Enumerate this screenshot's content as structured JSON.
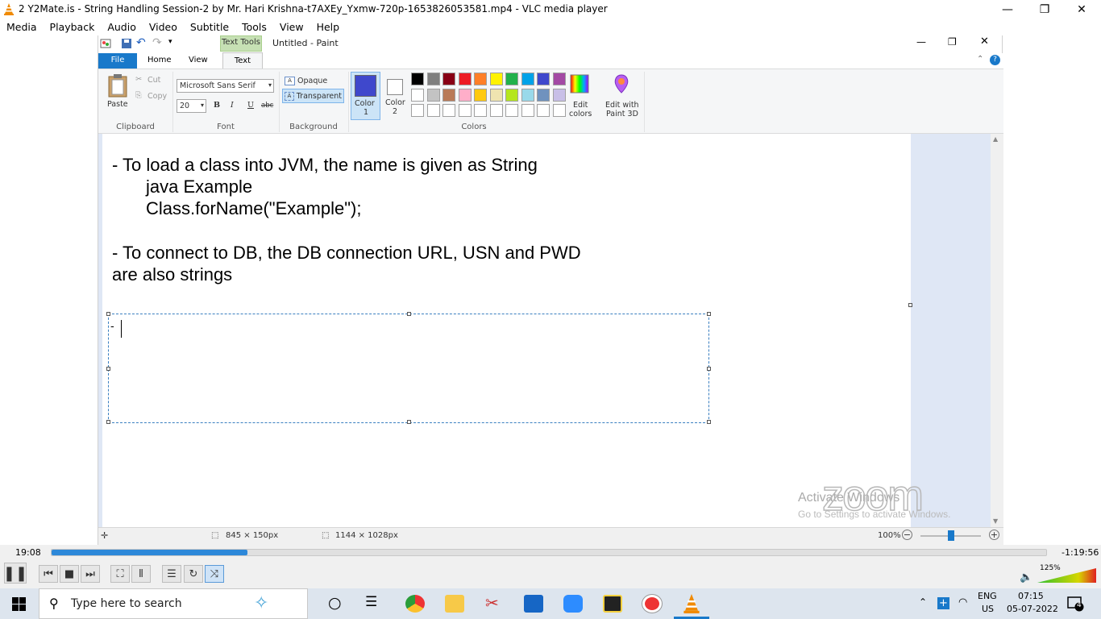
{
  "vlc": {
    "title": "2 Y2Mate.is - String Handling Session-2  by Mr. Hari Krishna-t7AXEy_Yxmw-720p-1653826053581.mp4 - VLC media player",
    "menu": [
      "Media",
      "Playback",
      "Audio",
      "Video",
      "Subtitle",
      "Tools",
      "View",
      "Help"
    ],
    "elapsed": "19:08",
    "remaining": "-1:19:56",
    "progress": 0.197,
    "volume_label": "125%",
    "volume_level": 1.0
  },
  "paint": {
    "title": "Untitled - Paint",
    "contextual_tab": "Text Tools",
    "tabs": [
      "File",
      "Home",
      "View",
      "Text"
    ],
    "clipboard": {
      "paste": "Paste",
      "cut": "Cut",
      "copy": "Copy",
      "label": "Clipboard"
    },
    "font": {
      "family": "Microsoft Sans Serif",
      "size": "20",
      "bold": "B",
      "italic": "I",
      "underline": "U",
      "strike": "abc",
      "label": "Font"
    },
    "background": {
      "opaque": "Opaque",
      "transparent": "Transparent",
      "label": "Background"
    },
    "colors": {
      "color1_label": "Color",
      "color1_num": "1",
      "color2_label": "Color",
      "color2_num": "2",
      "color1": "#3f48cc",
      "color2": "#ffffff",
      "edit_label_1": "Edit",
      "edit_label_2": "colors",
      "paint3d_1": "Edit with",
      "paint3d_2": "Paint 3D",
      "label": "Colors",
      "row1": [
        "#000000",
        "#7f7f7f",
        "#880015",
        "#ed1c24",
        "#ff7f27",
        "#fff200",
        "#22b14c",
        "#00a2e8",
        "#3f48cc",
        "#a349a4"
      ],
      "row2": [
        "#ffffff",
        "#c3c3c3",
        "#b97a57",
        "#ffaec9",
        "#ffc90e",
        "#efe4b0",
        "#b5e61d",
        "#99d9ea",
        "#7092be",
        "#c8bfe7"
      ]
    },
    "canvas_text": [
      "- To load a class into JVM, the name is given as String",
      "java Example",
      "Class.forName(\"Example\");",
      "- To connect to DB, the DB connection URL, USN  and PWD",
      "are also strings"
    ],
    "textbox_text": "-",
    "status": {
      "selection": "845 × 150px",
      "size": "1144 × 1028px",
      "zoom": "100%"
    }
  },
  "watermark": {
    "activate_1": "Activate Windows",
    "activate_2": "Go to Settings to activate Windows.",
    "zoom": "zoom"
  },
  "taskbar": {
    "search_placeholder": "Type here to search",
    "lang_1": "ENG",
    "lang_2": "US",
    "time": "07:15",
    "date": "05-07-2022",
    "notifications": "4"
  }
}
